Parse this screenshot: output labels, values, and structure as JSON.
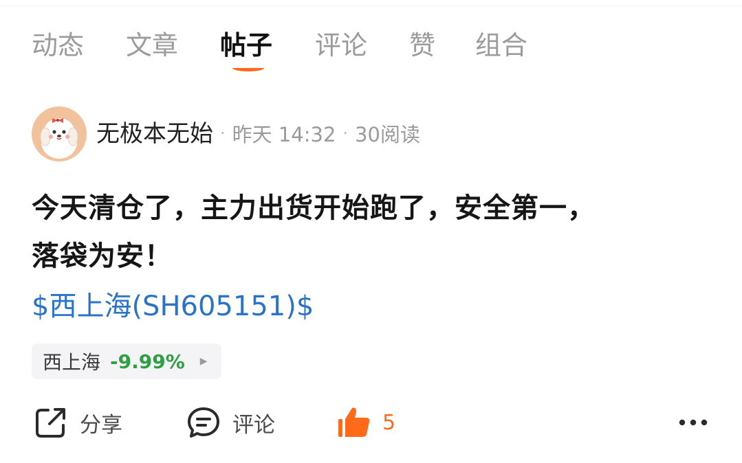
{
  "tabs": [
    {
      "label": "动态"
    },
    {
      "label": "文章"
    },
    {
      "label": "帖子"
    },
    {
      "label": "评论"
    },
    {
      "label": "赞"
    },
    {
      "label": "组合"
    }
  ],
  "post": {
    "author": "无极本无始",
    "separator": "·",
    "time": "昨天 14:32",
    "reads": "30阅读",
    "body_line1": "今天清仓了，主力出货开始跑了，安全第一，",
    "body_line2": "落袋为安！",
    "stock_link": "$西上海(SH605151)$",
    "stock_chip": {
      "name": "西上海",
      "change": "-9.99%",
      "arrow": "▶"
    }
  },
  "actions": {
    "share_label": "分享",
    "comment_label": "评论",
    "like_count": "5"
  },
  "colors": {
    "accent": "#ff6a1a",
    "link": "#2a73c9",
    "change": "#2ea043"
  },
  "icons": {
    "avatar": "cartoon-dog-avatar",
    "share": "share-icon",
    "comment": "comment-icon",
    "like": "thumbs-up-icon",
    "more": "more-icon"
  }
}
